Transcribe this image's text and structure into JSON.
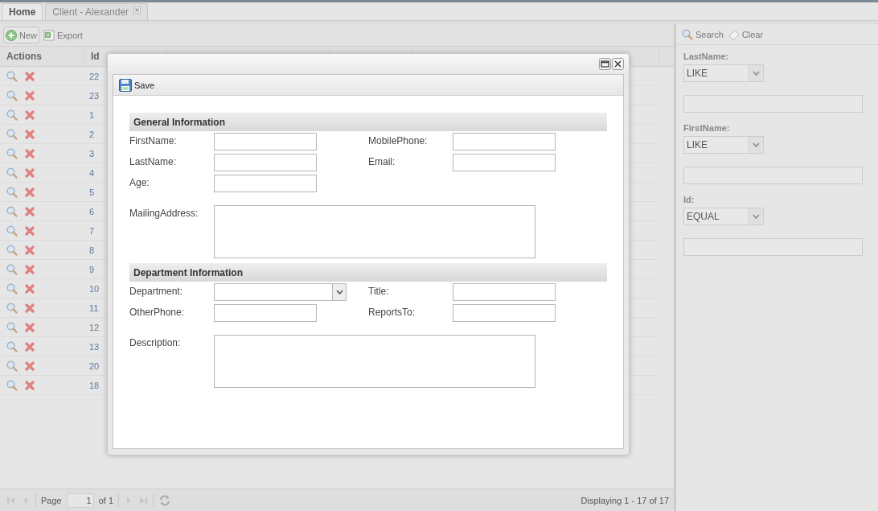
{
  "tabs": [
    {
      "label": "Home",
      "selected": true,
      "closable": false
    },
    {
      "label": "Client - Alexander",
      "selected": false,
      "closable": true
    }
  ],
  "toolbar": [
    {
      "kind": "new",
      "label": "New"
    },
    {
      "kind": "export",
      "label": "Export"
    }
  ],
  "grid": {
    "columns": [
      "Actions",
      "Id"
    ],
    "rows": [
      "22",
      "23",
      "1",
      "2",
      "3",
      "4",
      "5",
      "6",
      "7",
      "8",
      "9",
      "10",
      "11",
      "12",
      "13",
      "20",
      "18"
    ]
  },
  "paging": {
    "page_label": "Page",
    "page_value": "1",
    "of_label": "of 1",
    "display": "Displaying 1 - 17 of 17"
  },
  "filter_panel": {
    "buttons": [
      {
        "kind": "search",
        "label": "Search"
      },
      {
        "kind": "clear",
        "label": "Clear"
      }
    ],
    "filters": [
      {
        "label": "LastName:",
        "operator": "LIKE"
      },
      {
        "label": "FirstName:",
        "operator": "LIKE"
      },
      {
        "label": "Id:",
        "operator": "EQUAL"
      }
    ]
  },
  "dialog": {
    "save_label": "Save",
    "sections": [
      {
        "title": "General Information",
        "rows": [
          [
            {
              "label": "FirstName:",
              "kind": "text"
            },
            {
              "label": "MobilePhone:",
              "kind": "text"
            }
          ],
          [
            {
              "label": "LastName:",
              "kind": "text"
            },
            {
              "label": "Email:",
              "kind": "text"
            }
          ],
          [
            {
              "label": "Age:",
              "kind": "text"
            }
          ],
          [
            {
              "label": "MailingAddress:",
              "kind": "textarea"
            }
          ]
        ]
      },
      {
        "title": "Department Information",
        "rows": [
          [
            {
              "label": "Department:",
              "kind": "select"
            },
            {
              "label": "Title:",
              "kind": "text"
            }
          ],
          [
            {
              "label": "OtherPhone:",
              "kind": "text"
            },
            {
              "label": "ReportsTo:",
              "kind": "text"
            }
          ],
          [
            {
              "label": "Description:",
              "kind": "textarea"
            }
          ]
        ]
      }
    ]
  }
}
